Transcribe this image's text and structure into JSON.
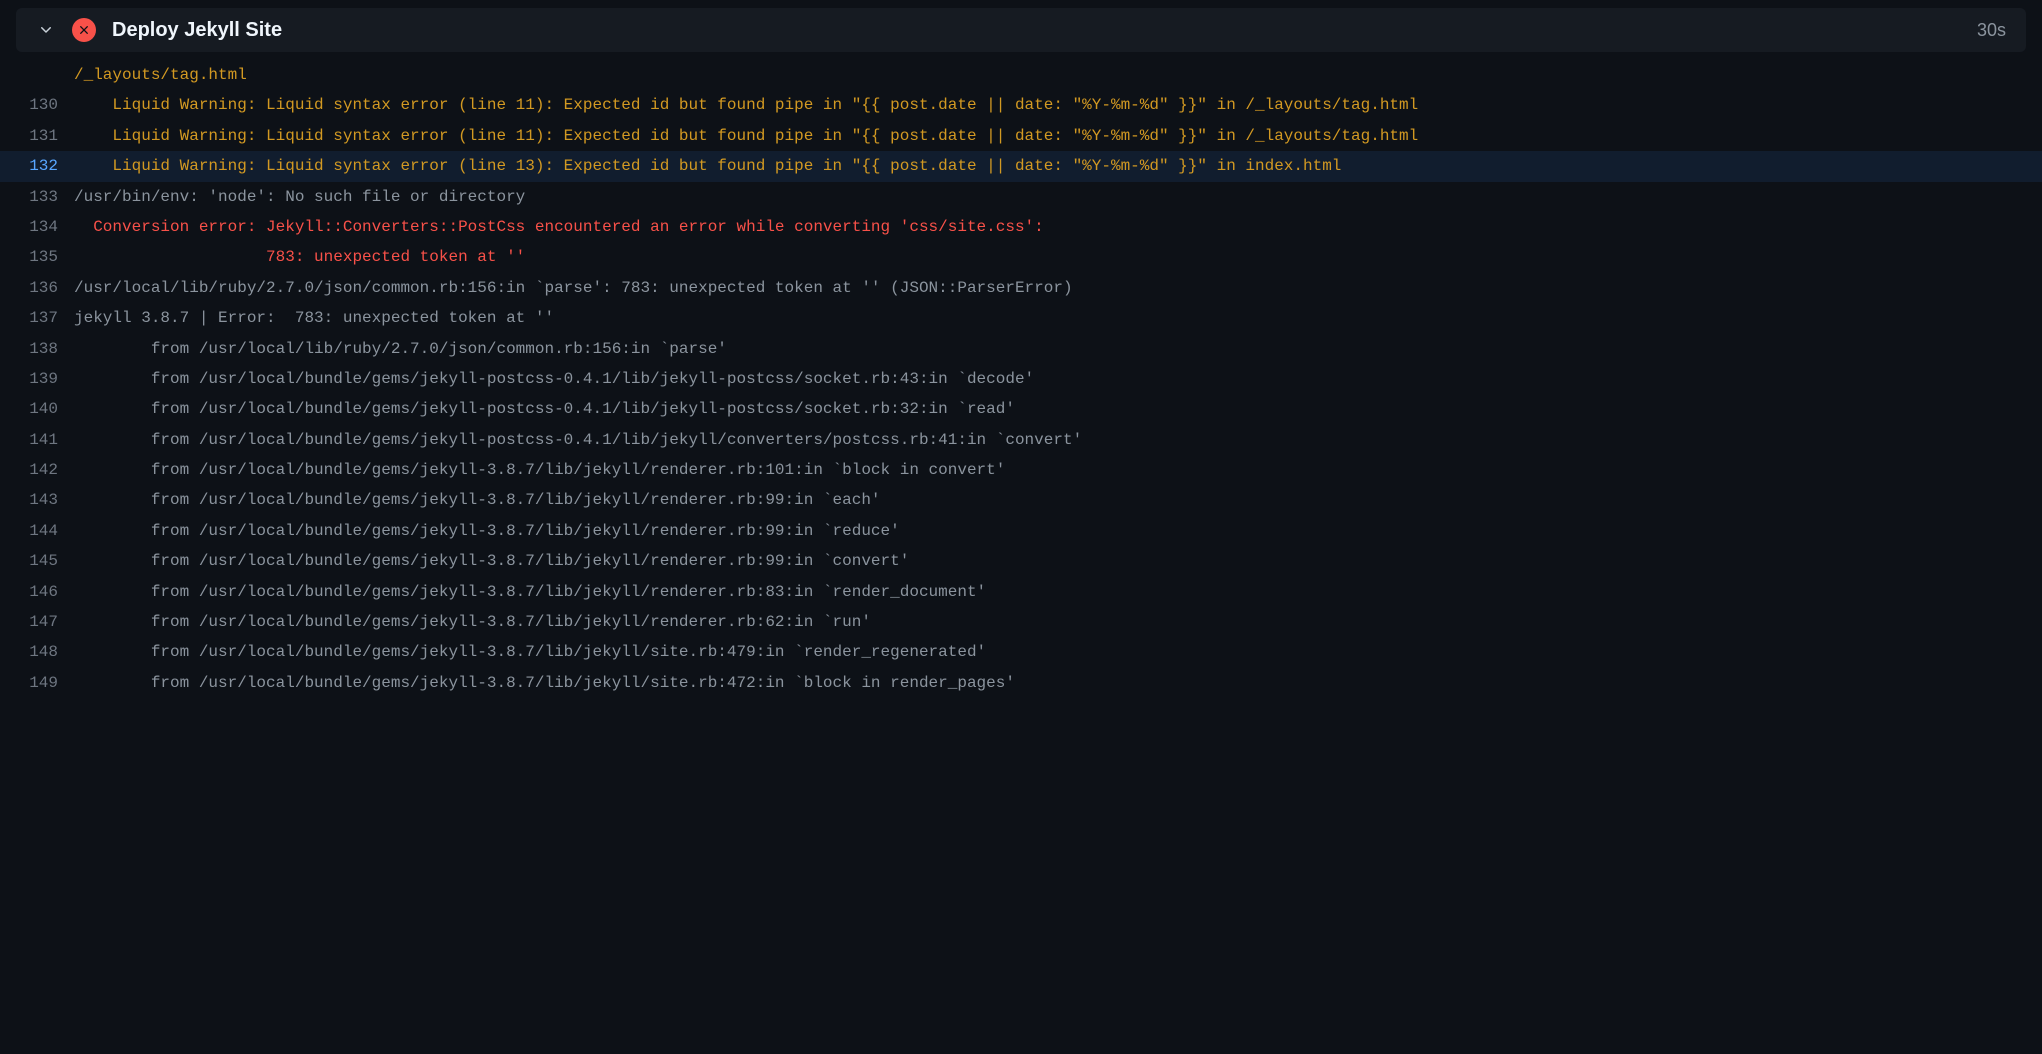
{
  "header": {
    "title": "Deploy Jekyll Site",
    "duration": "30s",
    "status": "error"
  },
  "log_lines": [
    {
      "n": null,
      "cls": "c-warn",
      "text": "/_layouts/tag.html"
    },
    {
      "n": 130,
      "cls": "c-warn",
      "text": "    Liquid Warning: Liquid syntax error (line 11): Expected id but found pipe in \"{{ post.date || date: \"%Y-%m-%d\" }}\" in /_layouts/tag.html"
    },
    {
      "n": 131,
      "cls": "c-warn",
      "text": "    Liquid Warning: Liquid syntax error (line 11): Expected id but found pipe in \"{{ post.date || date: \"%Y-%m-%d\" }}\" in /_layouts/tag.html"
    },
    {
      "n": 132,
      "cls": "c-warn",
      "highlighted": true,
      "text": "    Liquid Warning: Liquid syntax error (line 13): Expected id but found pipe in \"{{ post.date || date: \"%Y-%m-%d\" }}\" in index.html"
    },
    {
      "n": 133,
      "cls": "c-norm",
      "text": "/usr/bin/env: 'node': No such file or directory"
    },
    {
      "n": 134,
      "cls": "c-err",
      "text": "  Conversion error: Jekyll::Converters::PostCss encountered an error while converting 'css/site.css':"
    },
    {
      "n": 135,
      "cls": "c-err",
      "text": "                    783: unexpected token at ''"
    },
    {
      "n": 136,
      "cls": "c-norm",
      "text": "/usr/local/lib/ruby/2.7.0/json/common.rb:156:in `parse': 783: unexpected token at '' (JSON::ParserError)"
    },
    {
      "n": 137,
      "cls": "c-norm",
      "text": "jekyll 3.8.7 | Error:  783: unexpected token at ''"
    },
    {
      "n": 138,
      "cls": "c-norm",
      "text": "        from /usr/local/lib/ruby/2.7.0/json/common.rb:156:in `parse'"
    },
    {
      "n": 139,
      "cls": "c-norm",
      "text": "        from /usr/local/bundle/gems/jekyll-postcss-0.4.1/lib/jekyll-postcss/socket.rb:43:in `decode'"
    },
    {
      "n": 140,
      "cls": "c-norm",
      "text": "        from /usr/local/bundle/gems/jekyll-postcss-0.4.1/lib/jekyll-postcss/socket.rb:32:in `read'"
    },
    {
      "n": 141,
      "cls": "c-norm",
      "text": "        from /usr/local/bundle/gems/jekyll-postcss-0.4.1/lib/jekyll/converters/postcss.rb:41:in `convert'"
    },
    {
      "n": 142,
      "cls": "c-norm",
      "text": "        from /usr/local/bundle/gems/jekyll-3.8.7/lib/jekyll/renderer.rb:101:in `block in convert'"
    },
    {
      "n": 143,
      "cls": "c-norm",
      "text": "        from /usr/local/bundle/gems/jekyll-3.8.7/lib/jekyll/renderer.rb:99:in `each'"
    },
    {
      "n": 144,
      "cls": "c-norm",
      "text": "        from /usr/local/bundle/gems/jekyll-3.8.7/lib/jekyll/renderer.rb:99:in `reduce'"
    },
    {
      "n": 145,
      "cls": "c-norm",
      "text": "        from /usr/local/bundle/gems/jekyll-3.8.7/lib/jekyll/renderer.rb:99:in `convert'"
    },
    {
      "n": 146,
      "cls": "c-norm",
      "text": "        from /usr/local/bundle/gems/jekyll-3.8.7/lib/jekyll/renderer.rb:83:in `render_document'"
    },
    {
      "n": 147,
      "cls": "c-norm",
      "text": "        from /usr/local/bundle/gems/jekyll-3.8.7/lib/jekyll/renderer.rb:62:in `run'"
    },
    {
      "n": 148,
      "cls": "c-norm",
      "text": "        from /usr/local/bundle/gems/jekyll-3.8.7/lib/jekyll/site.rb:479:in `render_regenerated'"
    },
    {
      "n": 149,
      "cls": "c-norm",
      "text": "        from /usr/local/bundle/gems/jekyll-3.8.7/lib/jekyll/site.rb:472:in `block in render_pages'"
    }
  ]
}
